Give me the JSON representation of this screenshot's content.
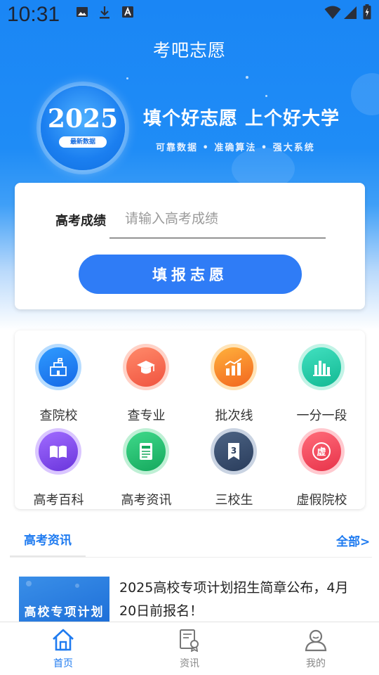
{
  "status_bar": {
    "time": "10:31"
  },
  "app": {
    "title": "考吧志愿"
  },
  "banner": {
    "year": "2025",
    "year_tag": "最新数据",
    "slogan": "填个好志愿 上个好大学",
    "subslogan": "可靠数据 • 准确算法 • 强大系统"
  },
  "score_form": {
    "label": "高考成绩",
    "placeholder": "请输入高考成绩",
    "submit_label": "填报志愿"
  },
  "features": [
    {
      "label": "查院校",
      "icon": "school-icon"
    },
    {
      "label": "查专业",
      "icon": "graduation-cap-icon"
    },
    {
      "label": "批次线",
      "icon": "bar-chart-icon"
    },
    {
      "label": "一分一段",
      "icon": "column-chart-icon"
    },
    {
      "label": "高考百科",
      "icon": "book-icon"
    },
    {
      "label": "高考资讯",
      "icon": "newspaper-icon"
    },
    {
      "label": "三校生",
      "icon": "bookmark-3-icon"
    },
    {
      "label": "虚假院校",
      "icon": "fake-school-icon"
    }
  ],
  "news": {
    "tab_label": "高考资讯",
    "all_label": "全部>",
    "items": [
      {
        "thumb_text": "高校专项计划",
        "title": "2025高校专项计划招生简章公布，4月20日前报名！"
      }
    ]
  },
  "tab_bar": {
    "tabs": [
      {
        "label": "首页",
        "icon": "home-icon",
        "active": true
      },
      {
        "label": "资讯",
        "icon": "news-certificate-icon",
        "active": false
      },
      {
        "label": "我的",
        "icon": "user-icon",
        "active": false
      }
    ],
    "active_color": "#1f7bf0",
    "inactive_color": "#888888"
  },
  "colors": {
    "primary": "#2f7cf6",
    "brand_blue": "#1a86f5"
  }
}
